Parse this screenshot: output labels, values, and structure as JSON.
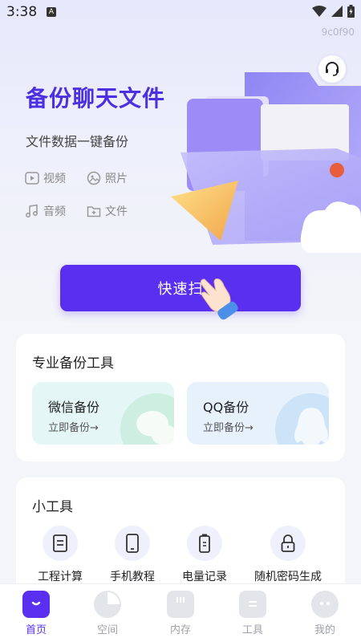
{
  "status_bar": {
    "time": "3:38",
    "notification_letter": "A",
    "icons": [
      "wifi-icon",
      "cellular-icon",
      "battery-icon"
    ]
  },
  "build_id": "9c0f90",
  "hero": {
    "title": "备份聊天文件",
    "subtitle": "文件数据一键备份",
    "features": [
      {
        "label": "视频",
        "icon": "video-icon"
      },
      {
        "label": "照片",
        "icon": "photo-icon"
      },
      {
        "label": "音频",
        "icon": "music-icon"
      },
      {
        "label": "文件",
        "icon": "file-icon"
      }
    ],
    "support_icon": "headset-icon"
  },
  "quick_button": {
    "label": "快速扫"
  },
  "backup_tools": {
    "title": "专业备份工具",
    "items": [
      {
        "name": "微信备份",
        "action": "立即备份→",
        "icon": "wechat-icon",
        "bg": "#e4f7f6",
        "deco": "#cdeee0"
      },
      {
        "name": "QQ备份",
        "action": "立即备份→",
        "icon": "qq-icon",
        "bg": "#e6f1fc",
        "deco": "#cde3f8"
      }
    ]
  },
  "mini_tools": {
    "title": "小工具",
    "items": [
      {
        "label": "工程计算",
        "icon": "calculator-icon"
      },
      {
        "label": "手机教程",
        "icon": "phone-icon"
      },
      {
        "label": "电量记录",
        "icon": "battery-record-icon"
      },
      {
        "label": "随机密码生成",
        "icon": "lock-icon"
      }
    ]
  },
  "tab_bar": {
    "active": 0,
    "tabs": [
      {
        "label": "首页",
        "icon": "home-icon"
      },
      {
        "label": "空间",
        "icon": "pie-chart-icon"
      },
      {
        "label": "内存",
        "icon": "sd-card-icon"
      },
      {
        "label": "工具",
        "icon": "toolbox-icon"
      },
      {
        "label": "我的",
        "icon": "profile-icon"
      }
    ]
  },
  "colors": {
    "accent": "#5a2ff0",
    "title": "#4b2fe0",
    "inactive": "#a0a2ad"
  }
}
